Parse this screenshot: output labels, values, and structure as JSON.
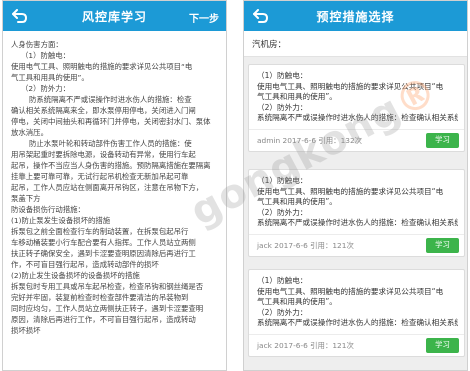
{
  "left": {
    "title": "风控库学习",
    "next_label": "下一步",
    "lines": [
      {
        "text": "人身伤害方面：",
        "indent": 0
      },
      {
        "text": "（1）防触电：",
        "indent": 1
      },
      {
        "text": "使用电气工具、照明触电的措施的要求详见公共项目“电",
        "indent": 0
      },
      {
        "text": "气工具和用具的使用”。",
        "indent": 0
      },
      {
        "text": "（2）防外力：",
        "indent": 1
      },
      {
        "text": "防系统隔离不严或误操作时进水伤人的措施：检查",
        "indent": 2
      },
      {
        "text": "确认相关系统隔离来全，即水泵停用停电，关闭进入门闸",
        "indent": 0
      },
      {
        "text": "停电，关闭中间抽头和再循环门并停电，关闭密封水门、泵体",
        "indent": 0
      },
      {
        "text": "放水消压。",
        "indent": 0
      },
      {
        "text": "防止水泵叶轮和转动部件伤害工作人员的措施：使",
        "indent": 2
      },
      {
        "text": "用吊架起重时要拆除电源，设备转动有异常，使用行车起",
        "indent": 0
      },
      {
        "text": "起吊，操作不当应当人身伤害的措施。预防隔离措施在要隔离",
        "indent": 0
      },
      {
        "text": "挂靠上要可靠可靠，无试行起吊机检查无新加吊起可靠",
        "indent": 0
      },
      {
        "text": "起吊，工作人员应站在侧面离开吊钩区，注意在吊物下方，",
        "indent": 0
      },
      {
        "text": "泵盖下方",
        "indent": 0
      },
      {
        "text": "防设备损伤行动措施：",
        "indent": 0
      },
      {
        "text": "(1)防止泵发生设备损坏的措施",
        "indent": 0
      },
      {
        "text": "拆泵包之前全面检查行车的制动装置，在拆泵包起吊行",
        "indent": 0
      },
      {
        "text": "车移动桶装要小行车配合要有人指挥。工作人员站立两侧",
        "indent": 0
      },
      {
        "text": "扶正转子确保安全，遇到卡涩要查明原因清除后再进行工",
        "indent": 0
      },
      {
        "text": "作，不可盲目强行起吊，造成转动部件的损坏",
        "indent": 0
      },
      {
        "text": "(2)防止发生设备损坏的设备损坏的措施",
        "indent": 0
      },
      {
        "text": "拆泵包时专用工具或吊车起吊检查，检查吊钩和钢丝绳是否",
        "indent": 0
      },
      {
        "text": "完好并牢固，装复前检查时检查部件要清洁的吊装物到",
        "indent": 0
      },
      {
        "text": "同时应均匀，工作人员站立两侧扶正转子，遇到卡涩要查明",
        "indent": 0
      },
      {
        "text": "原因，清除后再进行工作，不可盲目强行起吊，造成转动",
        "indent": 0
      },
      {
        "text": "损坏损坏",
        "indent": 0
      }
    ]
  },
  "right": {
    "title": "预控措施选择",
    "filter_label": "汽机房：",
    "learn_label": "学习",
    "cards": [
      {
        "lines": [
          "（1）防触电：",
          "使用电气工具、照明触电的措施的要求详见公共项目“电",
          "气工具和用具的使用”。",
          "（2）防外力：",
          "系统隔离不严或误操作时进水伤人的措施：检查确认相关系统隔离来全..."
        ],
        "meta": "admin   2017-6-6 引用：132次"
      },
      {
        "lines": [
          "（1）防触电：",
          "使用电气工具、照明触电的措施的要求详见公共项目“电",
          "气工具和用具的使用”。",
          "（2）防外力：",
          "系统隔离不严或误操作时进水伤人的措施：检查确认相关系统隔离来全..."
        ],
        "meta": "jack   2017-6-6 引用：121次"
      },
      {
        "lines": [
          "（1）防触电：",
          "使用电气工具、照明触电的措施的要求详见公共项目“电",
          "气工具和用具的使用”。",
          "（2）防外力：",
          "系统隔离不严或误操作时进水伤人的措施：检查确认相关系统隔离来全..."
        ],
        "meta": "jack   2017-6-6 引用：121次"
      }
    ]
  },
  "watermark": {
    "text": "gongkong",
    "suffix": "®"
  },
  "colors": {
    "header": "#1c9ad6",
    "learn_button": "#3cb44b",
    "background": "#eeeeee"
  }
}
